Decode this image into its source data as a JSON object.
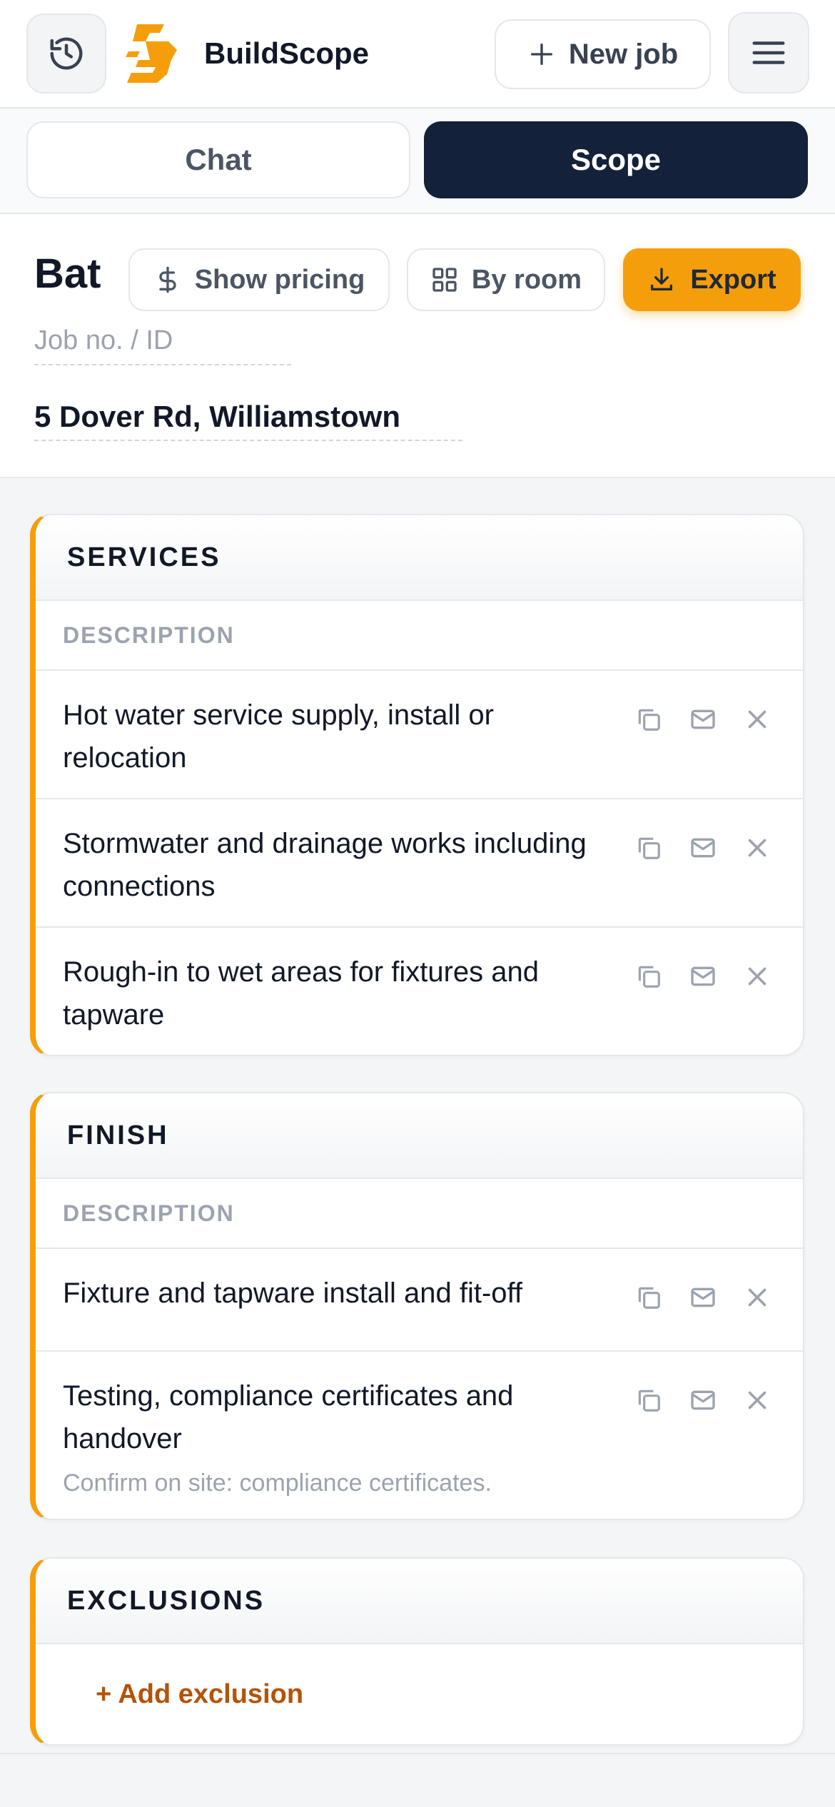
{
  "header": {
    "brand": "BuildScope",
    "new_job_label": "New job",
    "colors": {
      "accent": "#f59e0b",
      "dark": "#14213a"
    }
  },
  "tabs": [
    {
      "label": "Chat",
      "active": false
    },
    {
      "label": "Scope",
      "active": true
    }
  ],
  "job": {
    "title": "Bat",
    "show_pricing_label": "Show pricing",
    "by_room_label": "By room",
    "export_label": "Export",
    "job_no_placeholder": "Job no. / ID",
    "address": "5 Dover Rd, Williamstown"
  },
  "sections": [
    {
      "title": "SERVICES",
      "column": "DESCRIPTION",
      "rows": [
        {
          "text": "Hot water service supply, install or relocation"
        },
        {
          "text": "Stormwater and drainage works including connections"
        },
        {
          "text": "Rough-in to wet areas for fixtures and tapware"
        }
      ]
    },
    {
      "title": "FINISH",
      "column": "DESCRIPTION",
      "rows": [
        {
          "text": "Fixture and tapware install and fit-off"
        },
        {
          "text": "Testing, compliance certificates and handover",
          "note": "Confirm on site: compliance certificates."
        }
      ]
    },
    {
      "title": "EXCLUSIONS",
      "add_label": "+ Add exclusion"
    }
  ],
  "icons": {
    "history": "history-icon",
    "logo": "buildscope-logo",
    "plus": "plus-icon",
    "menu": "hamburger-menu-icon",
    "dollar": "dollar-icon",
    "grid": "grid-icon",
    "download": "download-icon",
    "copy": "copy-icon",
    "mail": "mail-icon",
    "close": "close-icon"
  }
}
